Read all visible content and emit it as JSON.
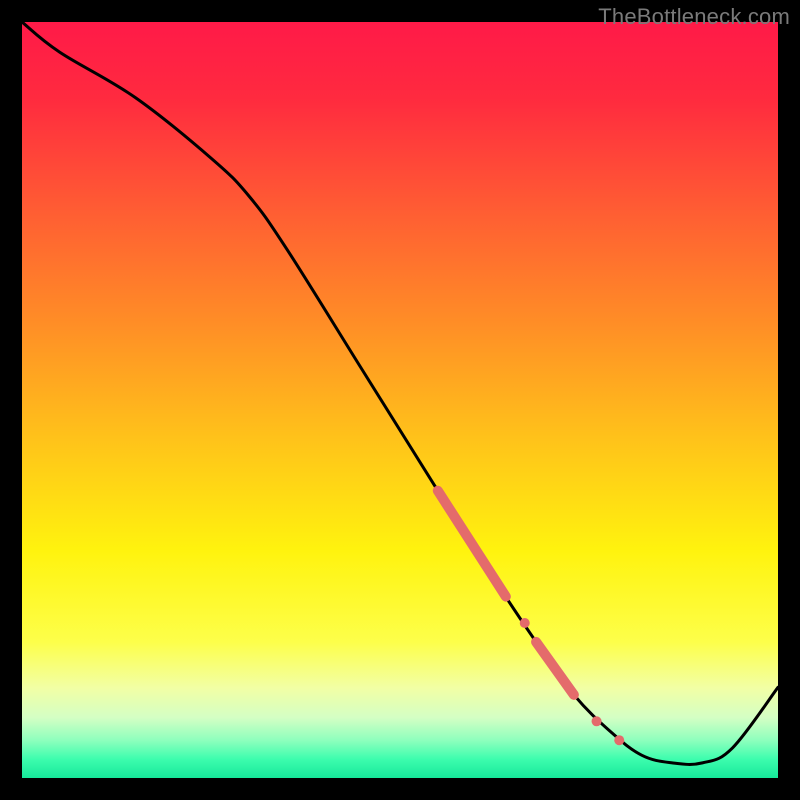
{
  "watermark": "TheBottleneck.com",
  "chart_data": {
    "type": "line",
    "title": "",
    "xlabel": "",
    "ylabel": "",
    "xlim": [
      0,
      100
    ],
    "ylim": [
      0,
      100
    ],
    "grid": false,
    "series": [
      {
        "name": "curve",
        "x": [
          0,
          5,
          15,
          25,
          30,
          35,
          45,
          55,
          62,
          68,
          73,
          78,
          82,
          86,
          90,
          94,
          100
        ],
        "y": [
          100,
          96,
          90,
          82,
          77,
          70,
          54,
          38,
          27,
          18,
          11,
          6,
          3,
          2,
          2,
          4,
          12
        ]
      }
    ],
    "highlight_segments": [
      {
        "x0": 55,
        "y0": 38,
        "x1": 64,
        "y1": 24,
        "thickness": 10
      },
      {
        "x0": 68,
        "y0": 18,
        "x1": 73,
        "y1": 11,
        "thickness": 10
      }
    ],
    "highlight_dots": [
      {
        "x": 66.5,
        "y": 20.5,
        "r": 5
      },
      {
        "x": 76,
        "y": 7.5,
        "r": 5
      },
      {
        "x": 79,
        "y": 5,
        "r": 5
      }
    ],
    "gradient_stops": [
      {
        "offset": 0.0,
        "color": "#ff1a48"
      },
      {
        "offset": 0.1,
        "color": "#ff2a3f"
      },
      {
        "offset": 0.25,
        "color": "#ff5d33"
      },
      {
        "offset": 0.4,
        "color": "#ff8e26"
      },
      {
        "offset": 0.55,
        "color": "#ffc21a"
      },
      {
        "offset": 0.7,
        "color": "#fff30e"
      },
      {
        "offset": 0.82,
        "color": "#fdff4a"
      },
      {
        "offset": 0.88,
        "color": "#f2ffa4"
      },
      {
        "offset": 0.92,
        "color": "#d4ffc4"
      },
      {
        "offset": 0.95,
        "color": "#8effbd"
      },
      {
        "offset": 0.975,
        "color": "#3dfdae"
      },
      {
        "offset": 1.0,
        "color": "#16e89a"
      }
    ],
    "highlight_color": "#e46b6b",
    "curve_color": "#000000"
  }
}
